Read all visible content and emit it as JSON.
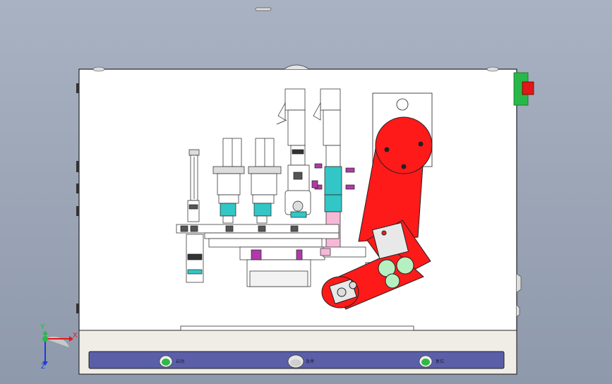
{
  "viewport": {
    "title_bar_icon": "minimize-bar-icon"
  },
  "panel": {
    "buttons": [
      {
        "name": "start-button",
        "label": "启动",
        "color": "#2fb84a"
      },
      {
        "name": "emergency-stop-button",
        "label": "急停",
        "color": "#e6e6e6"
      },
      {
        "name": "reset-button",
        "label": "复位",
        "color": "#2fb84a"
      }
    ],
    "bar_color": "#5a5fa8"
  },
  "triad": {
    "x_label": "X",
    "y_label": "Y",
    "z_label": "Z"
  },
  "colors": {
    "robot_arm": "#ff1a1a",
    "cyan_parts": "#33c6c6",
    "magenta_parts": "#b03aa8",
    "pink_sleeve": "#f7b8d8",
    "side_tab": "#28b84a",
    "side_tab_red": "#e01818"
  }
}
